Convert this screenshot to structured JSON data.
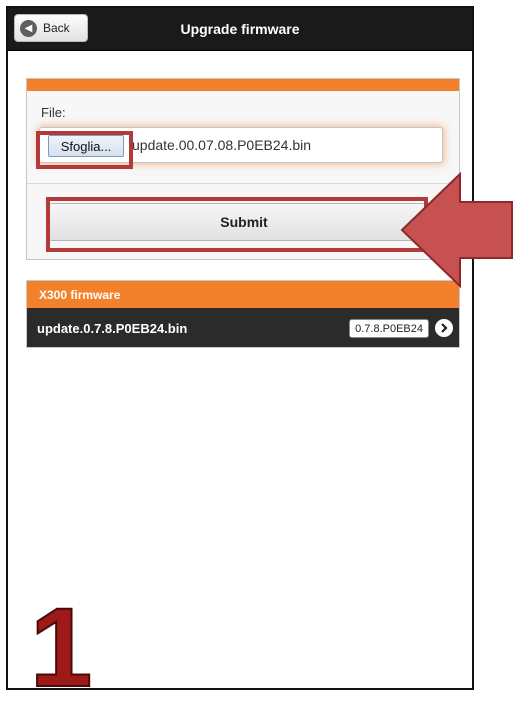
{
  "header": {
    "back_label": "Back",
    "title": "Upgrade firmware"
  },
  "form": {
    "file_label": "File:",
    "browse_label": "Sfoglia...",
    "file_name": "update.00.07.08.P0EB24.bin",
    "submit_label": "Submit"
  },
  "firmware_list": {
    "header": "X300 firmware",
    "items": [
      {
        "name": "update.0.7.8.P0EB24.bin",
        "version": "0.7.8.P0EB24"
      }
    ]
  },
  "annotation": {
    "step_number": "1"
  },
  "colors": {
    "accent": "#f3812b",
    "header_bg": "#1a1a1a",
    "highlight": "#b23a3a"
  }
}
